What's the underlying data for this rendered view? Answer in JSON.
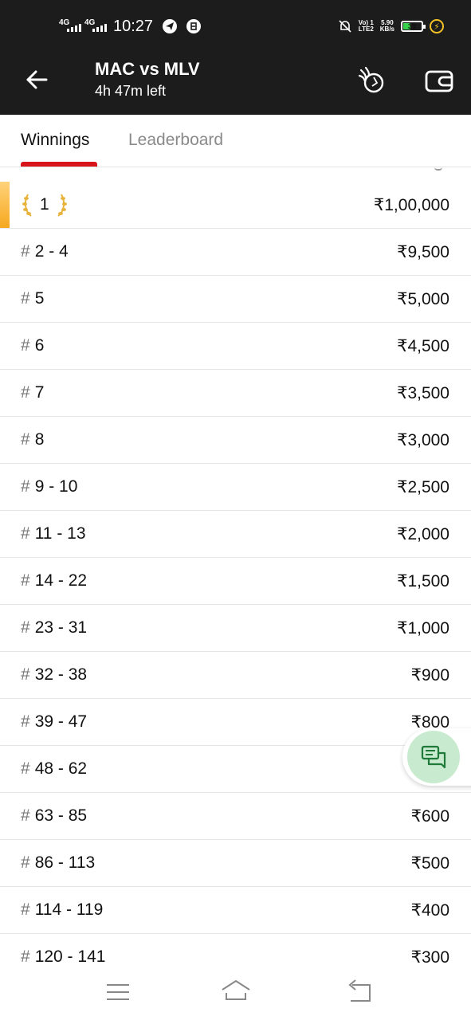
{
  "status_bar": {
    "signal1": "4G",
    "signal2": "4G",
    "time": "10:27",
    "net_top": "Vo) 1",
    "net_bottom": "LTE2",
    "speed_value": "5.90",
    "speed_unit": "KB/s",
    "battery": "39",
    "icons": [
      "telegram-icon",
      "app-icon",
      "mute-bell-icon",
      "charging-bolt-icon"
    ]
  },
  "header": {
    "title": "MAC vs MLV",
    "subtitle": "4h 47m left",
    "icons": [
      "back-arrow-icon",
      "ball-fire-icon",
      "wallet-icon"
    ]
  },
  "tabs": [
    {
      "label": "Winnings",
      "active": true
    },
    {
      "label": "Leaderboard",
      "active": false
    }
  ],
  "winnings": [
    {
      "rank": "1",
      "prize": "₹1,00,000"
    },
    {
      "rank": "2 - 4",
      "prize": "₹9,500"
    },
    {
      "rank": "5",
      "prize": "₹5,000"
    },
    {
      "rank": "6",
      "prize": "₹4,500"
    },
    {
      "rank": "7",
      "prize": "₹3,500"
    },
    {
      "rank": "8",
      "prize": "₹3,000"
    },
    {
      "rank": "9 - 10",
      "prize": "₹2,500"
    },
    {
      "rank": "11 - 13",
      "prize": "₹2,000"
    },
    {
      "rank": "14 - 22",
      "prize": "₹1,500"
    },
    {
      "rank": "23 - 31",
      "prize": "₹1,000"
    },
    {
      "rank": "32 - 38",
      "prize": "₹900"
    },
    {
      "rank": "39 - 47",
      "prize": "₹800"
    },
    {
      "rank": "48 - 62",
      "prize": ""
    },
    {
      "rank": "63 - 85",
      "prize": "₹600"
    },
    {
      "rank": "86 - 113",
      "prize": "₹500"
    },
    {
      "rank": "114 - 119",
      "prize": "₹400"
    },
    {
      "rank": "120 - 141",
      "prize": "₹300"
    }
  ],
  "hash_symbol": "#",
  "colors": {
    "header_bg": "#1c1c1c",
    "accent": "#d7141a",
    "gold": "#f6a81f",
    "chat_fab": "#c8ebd0"
  },
  "fab": {
    "icon": "chat-icon"
  },
  "nav": {
    "icons": [
      "menu-icon",
      "home-icon",
      "back-icon"
    ]
  }
}
